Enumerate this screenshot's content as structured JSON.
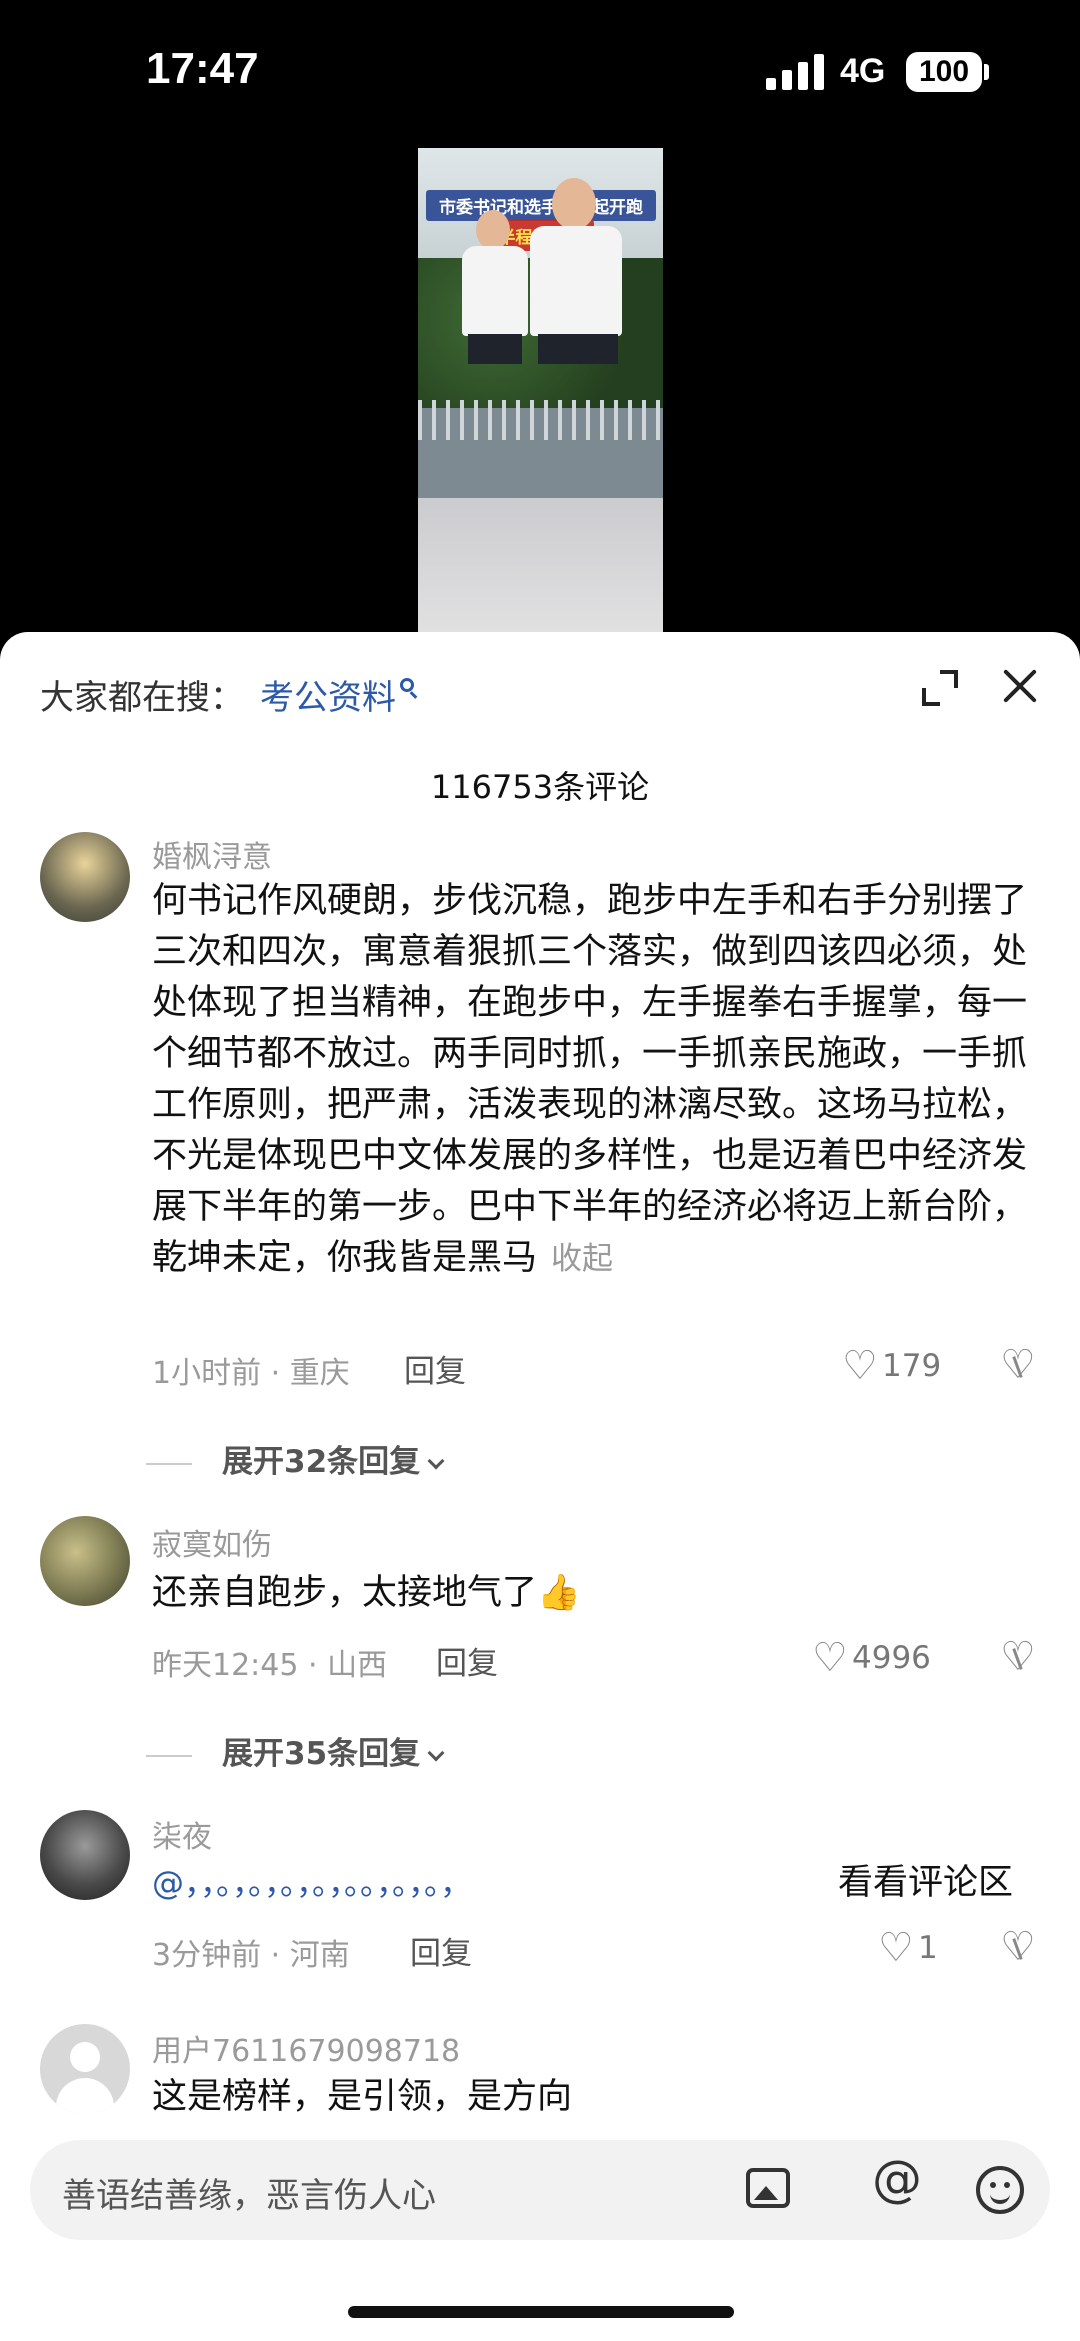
{
  "status_bar": {
    "time": "17:47",
    "network": "4G",
    "battery": "100"
  },
  "video": {
    "caption_line1": "市委书记和选手们一起开跑",
    "caption_line2": "半程马拉松"
  },
  "sheet": {
    "search_prefix": "大家都在搜：",
    "search_keyword": "考公资料",
    "comment_count": "116753条评论"
  },
  "comments": [
    {
      "username": "婚枫浔意",
      "text": "何书记作风硬朗，步伐沉稳，跑步中左手和右手分别摆了三次和四次，寓意着狠抓三个落实，做到四该四必须，处处体现了担当精神，在跑步中，左手握拳右手握掌，每一个细节都不放过。两手同时抓，一手抓亲民施政，一手抓工作原则，把严肃，活泼表现的淋漓尽致。这场马拉松，不光是体现巴中文体发展的多样性，也是迈着巴中经济发展下半年的第一步。巴中下半年的经济必将迈上新台阶，乾坤未定，你我皆是黑马",
      "collapse": "收起",
      "meta": "1小时前 · 重庆",
      "reply": "回复",
      "likes": "179",
      "expand_replies": "展开32条回复"
    },
    {
      "username": "寂寞如伤",
      "text": "还亲自跑步，太接地气了",
      "emoji": "👍",
      "meta": "昨天12:45 · 山西",
      "reply": "回复",
      "likes": "4996",
      "expand_replies": "展开35条回复"
    },
    {
      "username": "柒夜",
      "text": "@，，。，。，。，。，。。，。，。，",
      "extra": "看看评论区",
      "meta": "3分钟前 · 河南",
      "reply": "回复",
      "likes": "1"
    },
    {
      "username": "用户7611679098718",
      "text": "这是榜样，是引领，是方向"
    }
  ],
  "input": {
    "placeholder": "善语结善缘，恶言伤人心"
  },
  "icons": [
    "signal-icon",
    "battery-icon",
    "search-icon",
    "expand-icon",
    "close-icon",
    "heart-icon",
    "dislike-icon",
    "image-icon",
    "at-icon",
    "emoji-icon"
  ]
}
